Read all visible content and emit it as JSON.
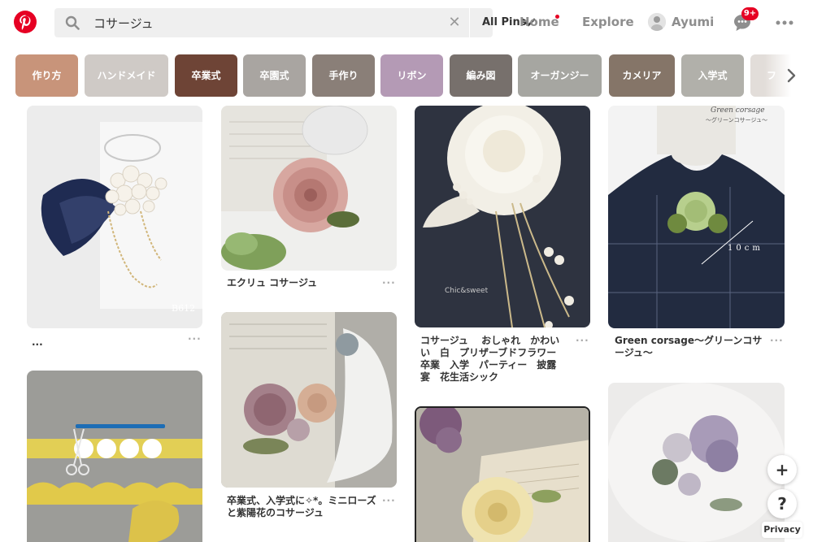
{
  "header": {
    "search": {
      "value": "コサージュ",
      "placeholder": ""
    },
    "filter_label": "All Pins",
    "nav": {
      "home": "Home",
      "explore": "Explore",
      "user": "Ayumi"
    },
    "notification_count": "9+"
  },
  "categories": [
    {
      "label": "作り方",
      "color": "#c8947a"
    },
    {
      "label": "ハンドメイド",
      "color": "#cfcac6"
    },
    {
      "label": "卒業式",
      "color": "#6e4436"
    },
    {
      "label": "卒園式",
      "color": "#a9a5a1"
    },
    {
      "label": "手作り",
      "color": "#8a7f78"
    },
    {
      "label": "リボン",
      "color": "#b49ab5"
    },
    {
      "label": "編み図",
      "color": "#77706c"
    },
    {
      "label": "オーガンジー",
      "color": "#a6a6a1"
    },
    {
      "label": "カメリア",
      "color": "#857568"
    },
    {
      "label": "入学式",
      "color": "#b1b0aa"
    },
    {
      "label": "フ",
      "color": "#e2ddd9"
    }
  ],
  "pins": {
    "p1": {
      "caption": "...",
      "more": "···"
    },
    "p3": {
      "caption": "エクリュ コサージュ",
      "more": "···"
    },
    "p4": {
      "caption": "卒業式、入学式に✧*。ミニローズと紫陽花のコサージュ",
      "more": "···"
    },
    "p5": {
      "caption": "コサージュ　 おしゃれ　かわいい　白　プリザーブドフラワー　卒業　入学　パーティー　披露宴　花生活シック",
      "more": "···"
    },
    "p7": {
      "caption": "Green corsage〜グリーンコサージュ〜",
      "more": "···"
    }
  },
  "image_text": {
    "p1_wm": "B612",
    "p5_wm": "Chic&sweet",
    "p7_title": "Green corsage",
    "p7_sub": "〜グリーンコサージュ〜",
    "p7_measure": "10cm"
  },
  "fab": {
    "add": "+",
    "help": "?"
  },
  "privacy": "Privacy",
  "icons": {
    "logo": "pinterest-logo-icon",
    "search": "search-icon",
    "clear": "close-icon",
    "dropdown": "chevron-down-icon",
    "chat": "chat-bubble-icon",
    "more": "more-dots-icon",
    "scroll": "chevron-right-icon"
  },
  "colors": {
    "brand": "#e60023",
    "search_bg": "#efefef",
    "nav_text": "#8e8e8e"
  }
}
